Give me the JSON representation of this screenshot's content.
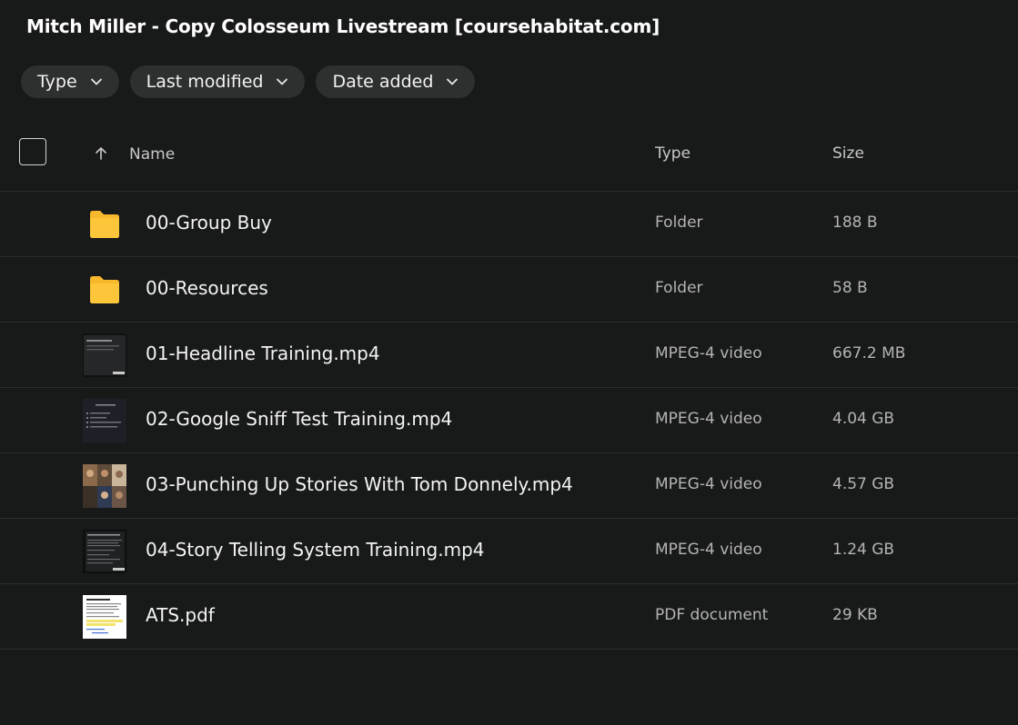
{
  "page": {
    "title": "Mitch Miller - Copy Colosseum Livestream [coursehabitat.com]"
  },
  "filters": [
    {
      "label": "Type"
    },
    {
      "label": "Last modified"
    },
    {
      "label": "Date added"
    }
  ],
  "table": {
    "columns": {
      "name": "Name",
      "type": "Type",
      "size": "Size"
    },
    "sort": {
      "column": "Name",
      "direction": "ascending"
    },
    "rows": [
      {
        "name": "00-Group Buy",
        "type": "Folder",
        "size": "188 B",
        "icon": "folder-icon"
      },
      {
        "name": "00-Resources",
        "type": "Folder",
        "size": "58 B",
        "icon": "folder-icon"
      },
      {
        "name": "01-Headline Training.mp4",
        "type": "MPEG-4 video",
        "size": "667.2 MB",
        "icon": "video-thumbnail"
      },
      {
        "name": "02-Google Sniff Test Training.mp4",
        "type": "MPEG-4 video",
        "size": "4.04 GB",
        "icon": "video-thumbnail"
      },
      {
        "name": "03-Punching Up Stories With Tom Donnely.mp4",
        "type": "MPEG-4 video",
        "size": "4.57 GB",
        "icon": "video-thumbnail"
      },
      {
        "name": "04-Story Telling System Training.mp4",
        "type": "MPEG-4 video",
        "size": "1.24 GB",
        "icon": "video-thumbnail"
      },
      {
        "name": "ATS.pdf",
        "type": "PDF document",
        "size": "29 KB",
        "icon": "pdf-thumbnail"
      }
    ]
  },
  "colors": {
    "background": "#181919",
    "chip": "#2e2f2f",
    "folder": "#f7b92b",
    "divider": "#2c2d2d"
  }
}
